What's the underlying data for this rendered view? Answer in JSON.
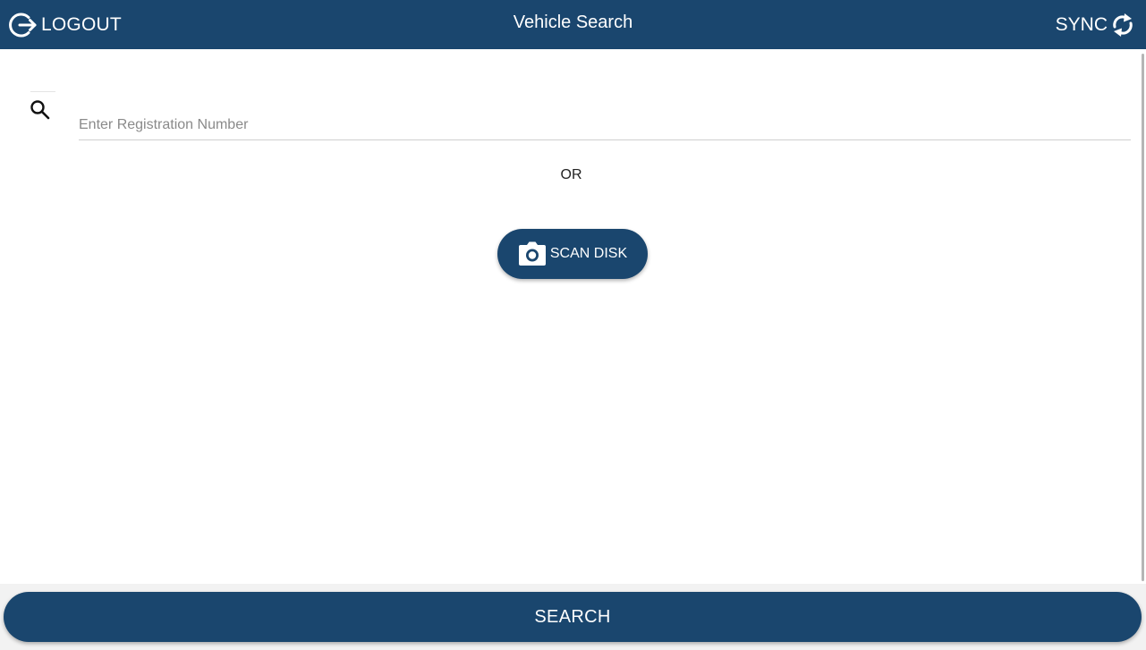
{
  "header": {
    "title": "Vehicle Search",
    "logout_label": "LOGOUT",
    "sync_label": "SYNC",
    "background_color": "#1a466e"
  },
  "search": {
    "placeholder": "Enter Registration Number",
    "value": "",
    "icon": "search-icon"
  },
  "separator": {
    "text": "OR"
  },
  "scan": {
    "label": "SCAN DISK",
    "icon": "camera-icon"
  },
  "footer": {
    "search_label": "SEARCH"
  },
  "icons": {
    "logout": "logout-icon",
    "sync": "sync-icon"
  }
}
